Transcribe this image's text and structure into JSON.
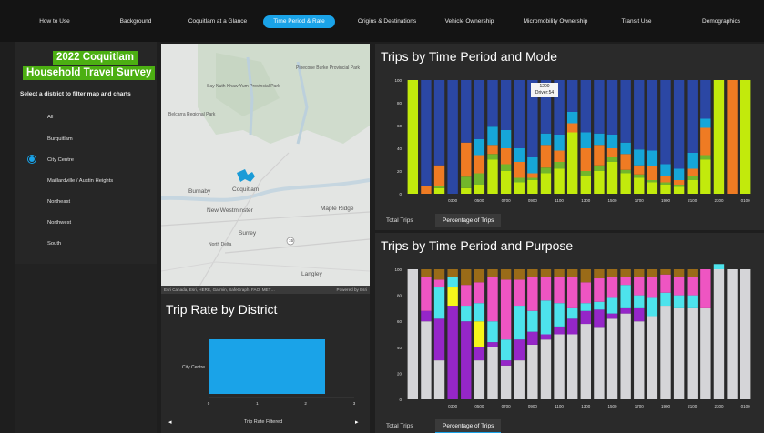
{
  "nav": {
    "tabs": [
      "How to Use",
      "Background",
      "Coquitlam at a Glance",
      "Time Period & Rate",
      "Origins & Destinations",
      "Vehicle Ownership",
      "Micromobility Ownership",
      "Transit Use",
      "Demographics"
    ],
    "active_index": 3,
    "accent": "#1aa3e8"
  },
  "sidebar": {
    "title_line1": "2022 Coquitlam",
    "title_line2": "Household Travel Survey",
    "hint": "Select a district to filter map and charts",
    "options": [
      "All",
      "Burquitlam",
      "City Centre",
      "Maillardville / Austin Heights",
      "Northeast",
      "Northwest",
      "South"
    ],
    "selected": "City Centre",
    "title_color": "#4caf12"
  },
  "map": {
    "labels": [
      "Pinecone Burke Provincial Park",
      "Say Nuth Khaw Yum Provincial Park",
      "Burnaby",
      "Coquitlam",
      "New Westminster",
      "Maple Ridge",
      "Surrey",
      "North Delta",
      "Langley",
      "Belcarra Regional Park"
    ],
    "route_shield": "15",
    "attribution": "Esri Canada, Esri, HERE, Garmin, SafeGraph, FAO, MET…",
    "powered_by": "Powered by Esri"
  },
  "trip_rate": {
    "title": "Trip Rate by District",
    "xlabel": "Trip Rate Filtered",
    "xticks": [
      "0",
      "1",
      "2",
      "3"
    ]
  },
  "mode_chart": {
    "title": "Trips by Time Period and Mode",
    "tabs": [
      "Total Trips",
      "Percentage of Trips"
    ],
    "active_tab": 1,
    "tooltip_line1": "1200",
    "tooltip_line2": "Driver:54",
    "colors": [
      "#c2ea0c",
      "#72b62b",
      "#ef7b23",
      "#16a6d8",
      "#2b47a4"
    ]
  },
  "purpose_chart": {
    "title": "Trips by Time Period and Purpose",
    "tabs": [
      "Total Trips",
      "Percentage of Trips"
    ],
    "active_tab": 1,
    "colors": [
      "#d5d5d8",
      "#9526c8",
      "#f6f61a",
      "#4de3ec",
      "#ee55c2",
      "#9a6b18"
    ]
  },
  "chart_data": [
    {
      "type": "bar",
      "title": "Trips by Time Period and Mode",
      "stacked": true,
      "categories": [
        "0000",
        "0100",
        "0200",
        "0300",
        "0400",
        "0500",
        "0600",
        "0700",
        "0800",
        "0900",
        "1000",
        "1100",
        "1200",
        "1300",
        "1400",
        "1500",
        "1600",
        "1700",
        "1800",
        "1900",
        "2000",
        "2100",
        "2200",
        "2300",
        "0000",
        "0100"
      ],
      "xticks": [
        "0300",
        "0500",
        "0700",
        "0900",
        "1100",
        "1300",
        "1500",
        "1700",
        "1900",
        "2100",
        "2300",
        "0100"
      ],
      "yticks": [
        "0",
        "20",
        "40",
        "60",
        "80",
        "100"
      ],
      "ylim": [
        0,
        100
      ],
      "series": [
        {
          "values": [
            100,
            0,
            5,
            0,
            5,
            8,
            30,
            20,
            10,
            12,
            18,
            22,
            54,
            16,
            20,
            28,
            18,
            14,
            10,
            8,
            6,
            12,
            30,
            100,
            0,
            100
          ]
        },
        {
          "values": [
            0,
            0,
            2,
            0,
            10,
            10,
            5,
            6,
            4,
            2,
            5,
            6,
            0,
            4,
            5,
            4,
            3,
            3,
            2,
            2,
            2,
            4,
            4,
            0,
            0,
            0
          ]
        },
        {
          "values": [
            0,
            7,
            18,
            0,
            30,
            16,
            8,
            14,
            14,
            4,
            20,
            10,
            8,
            20,
            18,
            8,
            14,
            8,
            12,
            6,
            4,
            6,
            24,
            0,
            100,
            0
          ]
        },
        {
          "values": [
            0,
            0,
            0,
            0,
            0,
            14,
            16,
            16,
            12,
            14,
            10,
            14,
            10,
            14,
            10,
            12,
            10,
            14,
            14,
            10,
            10,
            14,
            8,
            0,
            0,
            0
          ]
        },
        {
          "values": [
            0,
            93,
            75,
            100,
            55,
            52,
            41,
            44,
            60,
            68,
            47,
            48,
            28,
            46,
            47,
            48,
            55,
            61,
            62,
            74,
            78,
            64,
            34,
            0,
            0,
            0
          ]
        }
      ]
    },
    {
      "type": "bar",
      "title": "Trips by Time Period and Purpose",
      "stacked": true,
      "categories": [
        "0000",
        "0100",
        "0200",
        "0300",
        "0400",
        "0500",
        "0600",
        "0700",
        "0800",
        "0900",
        "1000",
        "1100",
        "1200",
        "1300",
        "1400",
        "1500",
        "1600",
        "1700",
        "1800",
        "1900",
        "2000",
        "2100",
        "2200",
        "2300",
        "0000",
        "0100"
      ],
      "xticks": [
        "0300",
        "0500",
        "0700",
        "0900",
        "1100",
        "1300",
        "1500",
        "1700",
        "1900",
        "2100",
        "2300",
        "0100"
      ],
      "yticks": [
        "0",
        "20",
        "40",
        "60",
        "80",
        "100"
      ],
      "ylim": [
        0,
        100
      ],
      "series": [
        {
          "values": [
            100,
            60,
            30,
            0,
            0,
            30,
            40,
            26,
            30,
            42,
            46,
            50,
            50,
            58,
            55,
            62,
            66,
            60,
            64,
            72,
            70,
            70,
            70,
            100,
            100,
            100
          ]
        },
        {
          "values": [
            0,
            8,
            32,
            72,
            60,
            10,
            4,
            4,
            16,
            10,
            4,
            6,
            12,
            10,
            14,
            4,
            4,
            10,
            0,
            0,
            0,
            0,
            0,
            0,
            0,
            0
          ]
        },
        {
          "values": [
            0,
            0,
            0,
            14,
            0,
            20,
            0,
            0,
            0,
            0,
            0,
            0,
            0,
            0,
            0,
            0,
            0,
            0,
            0,
            0,
            0,
            0,
            0,
            0,
            0,
            0
          ]
        },
        {
          "values": [
            0,
            0,
            24,
            8,
            12,
            14,
            16,
            16,
            26,
            16,
            26,
            18,
            8,
            6,
            6,
            12,
            18,
            10,
            14,
            10,
            10,
            10,
            0,
            4,
            0,
            0
          ]
        },
        {
          "values": [
            0,
            26,
            6,
            0,
            16,
            16,
            34,
            46,
            20,
            26,
            18,
            20,
            24,
            16,
            18,
            16,
            6,
            14,
            16,
            14,
            14,
            14,
            30,
            0,
            0,
            0
          ]
        },
        {
          "values": [
            0,
            6,
            8,
            6,
            12,
            10,
            6,
            8,
            8,
            6,
            6,
            6,
            6,
            10,
            7,
            6,
            6,
            6,
            6,
            4,
            6,
            6,
            0,
            0,
            0,
            0
          ]
        }
      ]
    },
    {
      "type": "bar",
      "title": "Trip Rate by District",
      "orientation": "horizontal",
      "categories": [
        "City Centre"
      ],
      "values": [
        2.4
      ],
      "xlabel": "Trip Rate Filtered",
      "xlim": [
        0,
        3
      ]
    }
  ]
}
